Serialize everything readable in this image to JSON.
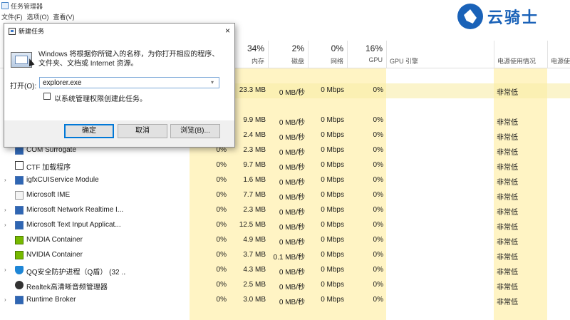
{
  "app": {
    "title": "任务管理器"
  },
  "menu": [
    {
      "label": "文件(F)"
    },
    {
      "label": "选项(O)"
    },
    {
      "label": "查看(V)"
    }
  ],
  "columns": {
    "cpu": {
      "pct": "",
      "label": ""
    },
    "memory": {
      "pct": "34%",
      "label": "内存"
    },
    "disk": {
      "pct": "2%",
      "label": "磁盘"
    },
    "network": {
      "pct": "0%",
      "label": "网络"
    },
    "gpu": {
      "pct": "16%",
      "label": "GPU"
    },
    "gpu_engine": {
      "label": "GPU 引擎"
    },
    "power": {
      "label": "电源使用情况"
    },
    "power_trend": {
      "label": "电源使"
    }
  },
  "processes": [
    {
      "name": "",
      "cpu": "",
      "mem": "23.3 MB",
      "disk": "0 MB/秒",
      "net": "0 Mbps",
      "gpu": "0%",
      "power": "非常低",
      "icon": "app-icon",
      "expandable": false,
      "heat": "dark"
    },
    {
      "name": "",
      "cpu": "",
      "mem": "",
      "disk": "",
      "net": "",
      "gpu": "",
      "power": "",
      "icon": "",
      "expandable": false,
      "heat": "dark"
    },
    {
      "name": "",
      "cpu": "",
      "mem": "9.9 MB",
      "disk": "0 MB/秒",
      "net": "0 Mbps",
      "gpu": "0%",
      "power": "非常低",
      "icon": "app-icon",
      "expandable": false
    },
    {
      "name": "",
      "cpu": "",
      "mem": "2.4 MB",
      "disk": "0 MB/秒",
      "net": "0 Mbps",
      "gpu": "0%",
      "power": "非常低",
      "icon": "app-icon",
      "expandable": false
    },
    {
      "name": "COM Surrogate",
      "cpu": "0%",
      "mem": "2.3 MB",
      "disk": "0 MB/秒",
      "net": "0 Mbps",
      "gpu": "0%",
      "power": "非常低",
      "icon": "window-icon",
      "expandable": false
    },
    {
      "name": "CTF 加载程序",
      "cpu": "0%",
      "mem": "9.7 MB",
      "disk": "0 MB/秒",
      "net": "0 Mbps",
      "gpu": "0%",
      "power": "非常低",
      "icon": "pen-icon",
      "expandable": false
    },
    {
      "name": "igfxCUIService Module",
      "cpu": "0%",
      "mem": "1.6 MB",
      "disk": "0 MB/秒",
      "net": "0 Mbps",
      "gpu": "0%",
      "power": "非常低",
      "icon": "window-icon",
      "expandable": true
    },
    {
      "name": "Microsoft IME",
      "cpu": "0%",
      "mem": "7.7 MB",
      "disk": "0 MB/秒",
      "net": "0 Mbps",
      "gpu": "0%",
      "power": "非常低",
      "icon": "ime-icon",
      "expandable": false
    },
    {
      "name": "Microsoft Network Realtime I...",
      "cpu": "0%",
      "mem": "2.3 MB",
      "disk": "0 MB/秒",
      "net": "0 Mbps",
      "gpu": "0%",
      "power": "非常低",
      "icon": "window-icon",
      "expandable": true
    },
    {
      "name": "Microsoft Text Input Applicat...",
      "cpu": "0%",
      "mem": "12.5 MB",
      "disk": "0 MB/秒",
      "net": "0 Mbps",
      "gpu": "0%",
      "power": "非常低",
      "icon": "window-icon",
      "expandable": true
    },
    {
      "name": "NVIDIA Container",
      "cpu": "0%",
      "mem": "4.9 MB",
      "disk": "0 MB/秒",
      "net": "0 Mbps",
      "gpu": "0%",
      "power": "非常低",
      "icon": "nvidia-icon",
      "expandable": false
    },
    {
      "name": "NVIDIA Container",
      "cpu": "0%",
      "mem": "3.7 MB",
      "disk": "0.1 MB/秒",
      "net": "0 Mbps",
      "gpu": "0%",
      "power": "非常低",
      "icon": "nvidia-icon",
      "expandable": false
    },
    {
      "name": "QQ安全防护进程（Q盾）  (32 ...",
      "cpu": "0%",
      "mem": "4.3 MB",
      "disk": "0 MB/秒",
      "net": "0 Mbps",
      "gpu": "0%",
      "power": "非常低",
      "icon": "qq-shield-icon",
      "expandable": true
    },
    {
      "name": "Realtek高清晰音频管理器",
      "cpu": "0%",
      "mem": "2.5 MB",
      "disk": "0 MB/秒",
      "net": "0 Mbps",
      "gpu": "0%",
      "power": "非常低",
      "icon": "speaker-icon",
      "expandable": false
    },
    {
      "name": "Runtime Broker",
      "cpu": "0%",
      "mem": "3.0 MB",
      "disk": "0 MB/秒",
      "net": "0 Mbps",
      "gpu": "0%",
      "power": "非常低",
      "icon": "window-icon",
      "expandable": true
    }
  ],
  "run_dialog": {
    "title": "新建任务",
    "close": "×",
    "description": "Windows 将根据你所键入的名称，为你打开相应的程序、文件夹、文档或 Internet 资源。",
    "open_label": "打开(O):",
    "input_value": "explorer.exe",
    "admin_checkbox_label": "以系统管理权限创建此任务。",
    "admin_checked": false,
    "ok_label": "确定",
    "cancel_label": "取消",
    "browse_label": "浏览(B)..."
  },
  "watermark": {
    "text": "云骑士"
  },
  "colors": {
    "heat_light": "#fff4c4",
    "heat_dark": "#f9eca8",
    "accent": "#0078d7",
    "watermark": "#1a62b8"
  }
}
